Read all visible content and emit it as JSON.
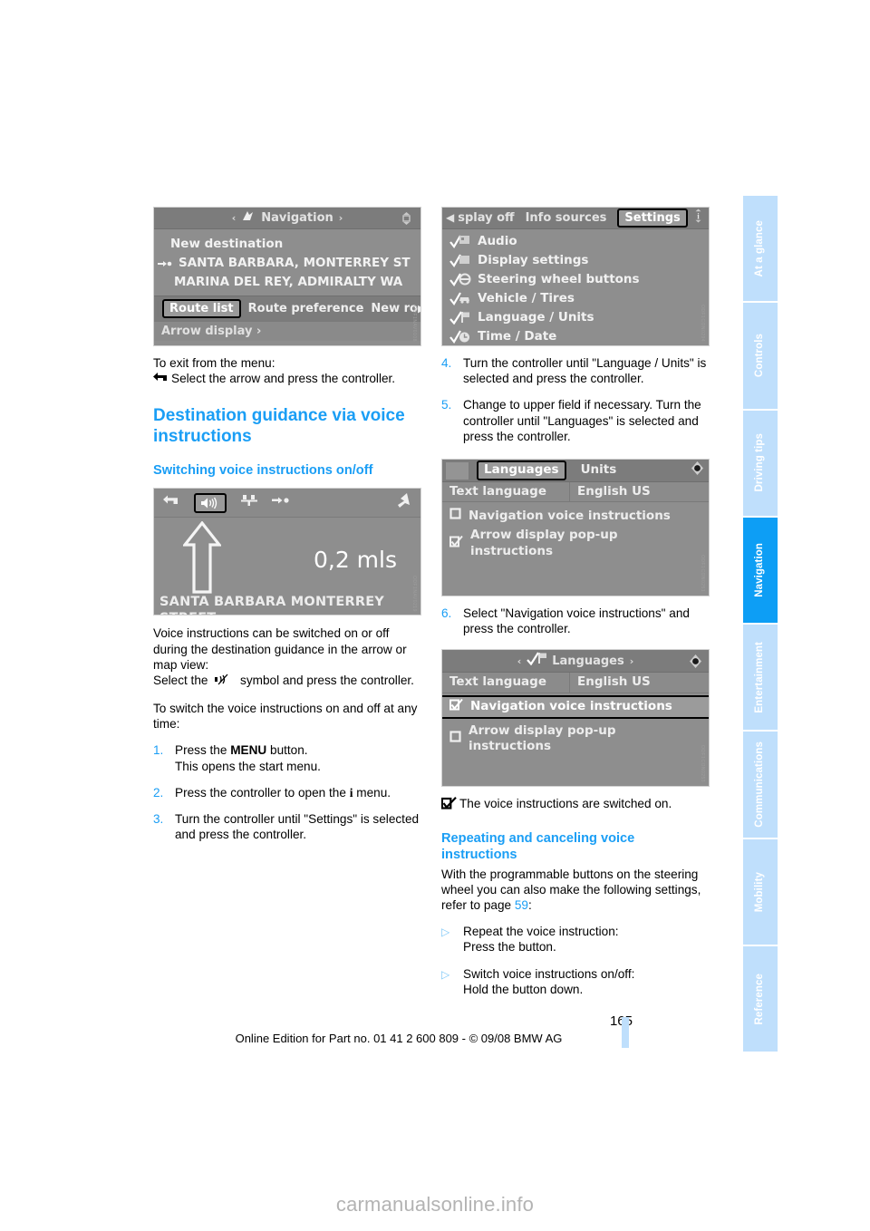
{
  "sidebar": {
    "tabs": [
      {
        "label": "At a glance",
        "active": false
      },
      {
        "label": "Controls",
        "active": false
      },
      {
        "label": "Driving tips",
        "active": false
      },
      {
        "label": "Navigation",
        "active": true
      },
      {
        "label": "Entertainment",
        "active": false
      },
      {
        "label": "Communications",
        "active": false
      },
      {
        "label": "Mobility",
        "active": false
      },
      {
        "label": "Reference",
        "active": false
      }
    ],
    "active_color": "#0d9ef5",
    "inactive_color": "#bfdffc"
  },
  "colors": {
    "heading_blue": "#1a9ef5",
    "screenshot_gray": "#8e8e8e",
    "screenshot_bar": "#7c7c7c"
  },
  "screenshots": {
    "navigation_menu": {
      "title": "Navigation",
      "left_arrow": "‹",
      "right_arrow": "›",
      "icon": "navigation-flag-icon",
      "items": [
        "New destination",
        "SANTA BARBARA, MONTERREY ST",
        "MARINA DEL REY, ADMIRALTY WA"
      ],
      "footer_selected": "Route list",
      "footer_items": [
        "Route preference",
        "New ro"
      ],
      "footer_scroll": "▶",
      "bottom_row": "Arrow display ›"
    },
    "settings_menu": {
      "tabs": [
        "splay off",
        "Info sources",
        "Settings"
      ],
      "selected_tab": "Settings",
      "info_icon": "info-icon",
      "items": [
        {
          "label": "Audio",
          "icon": "audio-check-icon"
        },
        {
          "label": "Display settings",
          "icon": "display-check-icon"
        },
        {
          "label": "Steering wheel buttons",
          "icon": "steering-check-icon"
        },
        {
          "label": "Vehicle / Tires",
          "icon": "vehicle-check-icon"
        },
        {
          "label": "Language / Units",
          "icon": "language-check-icon"
        },
        {
          "label": "Time / Date",
          "icon": "time-check-icon"
        }
      ]
    },
    "arrow_display": {
      "toolbar_icons": [
        "back-icon",
        "speaker-icon",
        "junction-icon",
        "destination-icon",
        "exit-arrow-icon"
      ],
      "selected_icon": "speaker-icon",
      "distance": "0,2 mls",
      "street": "SANTA BARBARA MONTERREY STREET"
    },
    "languages_units": {
      "tabs": [
        "Languages",
        "Units"
      ],
      "selected_tab": "Languages",
      "dot_icon": "controller-dot-icon",
      "row_label": "Text language",
      "row_value": "English US",
      "options": [
        {
          "label": "Navigation voice instructions",
          "checked": false,
          "highlighted": false
        },
        {
          "label": "Arrow display pop-up instructions",
          "checked": true,
          "highlighted": false
        }
      ]
    },
    "languages_selected": {
      "title": "Languages",
      "left_arrow": "‹",
      "right_arrow": "›",
      "icon": "language-check-icon",
      "dot_icon": "controller-dot-icon",
      "row_label": "Text language",
      "row_value": "English US",
      "options": [
        {
          "label": "Navigation voice instructions",
          "checked": true,
          "highlighted": true
        },
        {
          "label": "Arrow display pop-up instructions",
          "checked": false,
          "highlighted": false
        }
      ]
    }
  },
  "left_column": {
    "exit_intro": "To exit from the menu:",
    "exit_icon": "back-arrow-icon",
    "exit_text": "Select the arrow and press the controller.",
    "section_title": "Destination guidance via voice instructions",
    "subsection_title": "Switching voice instructions on/off",
    "para1": "Voice instructions can be switched on or off during the destination guidance in the arrow or map view:",
    "para2_before": "Select the",
    "para2_icon": "muted-speaker-icon",
    "para2_after": "symbol and press the controller.",
    "para3": "To switch the voice instructions on and off at any time:",
    "steps": [
      {
        "num": "1.",
        "line1_pre": "Press the ",
        "line1_bold": "MENU",
        "line1_post": " button.",
        "line2": "This opens the start menu."
      },
      {
        "num": "2.",
        "line1_pre": "Press the controller to open the ",
        "line1_bold": "i",
        "line1_post": " menu.",
        "line2": ""
      },
      {
        "num": "3.",
        "line1_pre": "Turn the controller until \"Settings\" is selected and press the controller.",
        "line1_bold": "",
        "line1_post": "",
        "line2": ""
      }
    ]
  },
  "right_column": {
    "steps_top": [
      {
        "num": "4.",
        "text": "Turn the controller until \"Language / Units\" is selected and press the controller."
      },
      {
        "num": "5.",
        "text": "Change to upper field if necessary. Turn the controller until \"Languages\" is selected and press the controller."
      }
    ],
    "step6": {
      "num": "6.",
      "text": "Select \"Navigation voice instructions\" and press the controller."
    },
    "result_icon": "checked-box-icon",
    "result_text": "The voice instructions are switched on.",
    "section_title": "Repeating and canceling voice instructions",
    "para1_pre": "With the programmable buttons on the steering wheel you can also make the following settings, refer to page ",
    "para1_link": "59",
    "para1_post": ":",
    "bullets": [
      {
        "marker": "▷",
        "line1": "Repeat the voice instruction:",
        "line2": "Press the button."
      },
      {
        "marker": "▷",
        "line1": "Switch voice instructions on/off:",
        "line2": "Hold the button down."
      }
    ]
  },
  "footer": {
    "page_number": "165",
    "edition": "Online Edition for Part no. 01 41 2 600 809 - © 09/08 BMW AG",
    "watermark": "carmanualsonline.info"
  }
}
